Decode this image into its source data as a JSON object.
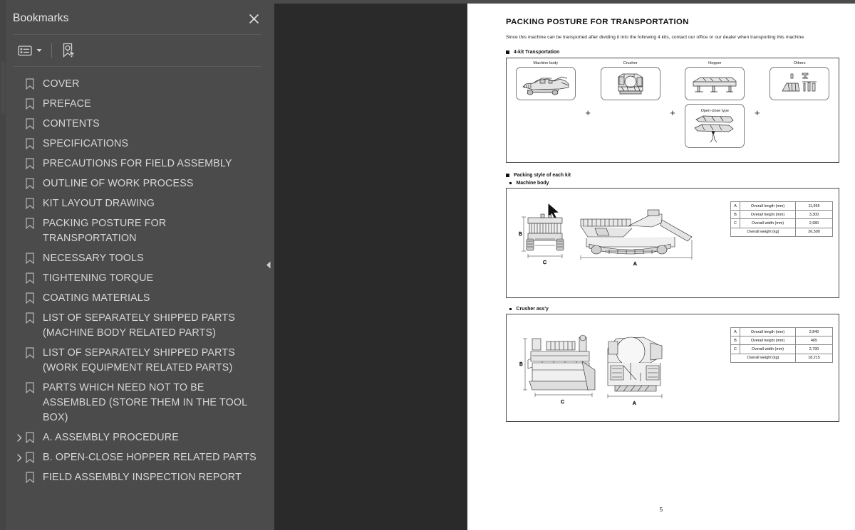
{
  "sidebar": {
    "title": "Bookmarks",
    "close_icon": "close-icon",
    "toolbar": {
      "options_icon": "list-options-icon",
      "caret_icon": "chevron-down-icon",
      "new_bookmark_icon": "new-bookmark-icon"
    },
    "items": [
      {
        "label": "COVER",
        "expandable": false
      },
      {
        "label": "PREFACE",
        "expandable": false
      },
      {
        "label": "CONTENTS",
        "expandable": false
      },
      {
        "label": "SPECIFICATIONS",
        "expandable": false
      },
      {
        "label": "PRECAUTIONS FOR FIELD ASSEMBLY",
        "expandable": false
      },
      {
        "label": "OUTLINE OF WORK PROCESS",
        "expandable": false
      },
      {
        "label": "KIT LAYOUT DRAWING",
        "expandable": false
      },
      {
        "label": "PACKING POSTURE FOR TRANSPORTATION",
        "expandable": false
      },
      {
        "label": "NECESSARY TOOLS",
        "expandable": false
      },
      {
        "label": "TIGHTENING TORQUE",
        "expandable": false
      },
      {
        "label": "COATING MATERIALS",
        "expandable": false
      },
      {
        "label": "LIST OF SEPARATELY SHIPPED PARTS (MACHINE BODY RELATED PARTS)",
        "expandable": false
      },
      {
        "label": "LIST OF SEPARATELY SHIPPED PARTS (WORK EQUIPMENT RELATED PARTS)",
        "expandable": false
      },
      {
        "label": "PARTS WHICH NEED NOT TO BE ASSEMBLED (STORE THEM IN THE TOOL BOX)",
        "expandable": false
      },
      {
        "label": "A. ASSEMBLY PROCEDURE",
        "expandable": true
      },
      {
        "label": "B. OPEN-CLOSE HOPPER RELATED PARTS",
        "expandable": true
      },
      {
        "label": "FIELD ASSEMBLY INSPECTION REPORT",
        "expandable": false
      }
    ]
  },
  "viewer": {
    "collapse_icon": "collapse-panel-arrow-icon",
    "page_number": "5"
  },
  "document": {
    "title": "PACKING POSTURE FOR TRANSPORTATION",
    "intro": "Since this machine can be transported after dividing it into the following 4 kits, contact our office or our dealer when transporting this machine.",
    "section1_heading": "4-kit Transportation",
    "kits": [
      {
        "caption": "Machine body",
        "icon": "machine-body-illustration"
      },
      {
        "caption": "Crusher",
        "icon": "crusher-illustration"
      },
      {
        "caption": "Hopper",
        "icon": "hopper-illustration",
        "sub_caption": "Open-close type",
        "sub_icon": "open-close-hopper-illustration"
      },
      {
        "caption": "Others",
        "icon": "other-parts-illustration"
      }
    ],
    "kit_separator": "+",
    "section2_heading": "Packing style of each kit",
    "subsections": [
      {
        "heading": "Machine body",
        "drawing_labels": {
          "height": "B",
          "width": "C",
          "length": "A"
        },
        "table": [
          {
            "key": "A",
            "label": "Overall length (mm)",
            "value": "11,955"
          },
          {
            "key": "B",
            "label": "Overall height (mm)",
            "value": "3,300"
          },
          {
            "key": "C",
            "label": "Overall width (mm)",
            "value": "2,980"
          },
          {
            "key": "",
            "label": "Overall weight (kg)",
            "value": "26,500"
          }
        ]
      },
      {
        "heading": "Crusher ass'y",
        "drawing_labels": {
          "height": "B",
          "width": "C",
          "length": "A"
        },
        "table": [
          {
            "key": "A",
            "label": "Overall length (mm)",
            "value": "2,840"
          },
          {
            "key": "B",
            "label": "Overall height (mm)",
            "value": "465"
          },
          {
            "key": "C",
            "label": "Overall width (mm)",
            "value": "2,790"
          },
          {
            "key": "",
            "label": "Overall weight (kg)",
            "value": "18,215"
          }
        ]
      }
    ]
  },
  "colors": {
    "sidebar_bg": "#4b4b4b",
    "viewer_bg": "#2a2a2a",
    "page_bg": "#ffffff",
    "text_light": "#d7d7d7"
  }
}
